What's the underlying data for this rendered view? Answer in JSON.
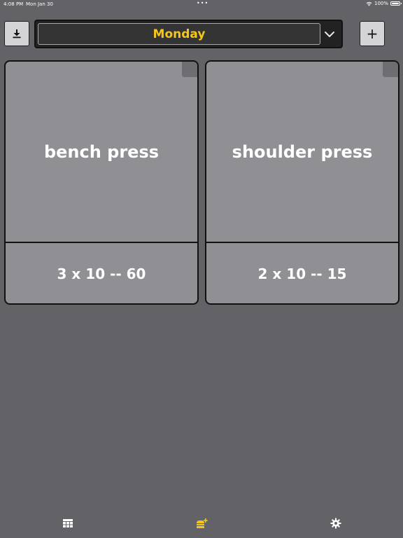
{
  "status_bar": {
    "time": "4:08 PM",
    "date": "Mon Jan 30",
    "dots": "•••",
    "battery": "100%",
    "wifi_icon": "wifi-icon",
    "battery_icon": "battery-icon"
  },
  "toolbar": {
    "download_icon": "download-icon",
    "selected_day": "Monday",
    "dropdown_icon": "chevron-down-icon",
    "add_label": "+"
  },
  "exercises": [
    {
      "name": "bench press",
      "detail": "3 x 10 -- 60"
    },
    {
      "name": "shoulder press",
      "detail": "2 x 10 -- 15"
    }
  ],
  "tab_bar": {
    "tabs": [
      {
        "icon": "table-icon"
      },
      {
        "icon": "workout-icon",
        "active": true
      },
      {
        "icon": "gear-icon"
      }
    ]
  },
  "colors": {
    "background": "#636266",
    "card": "#908f93",
    "accent": "#f5c518",
    "border": "#111111",
    "tab_inactive": "#ffffff"
  }
}
